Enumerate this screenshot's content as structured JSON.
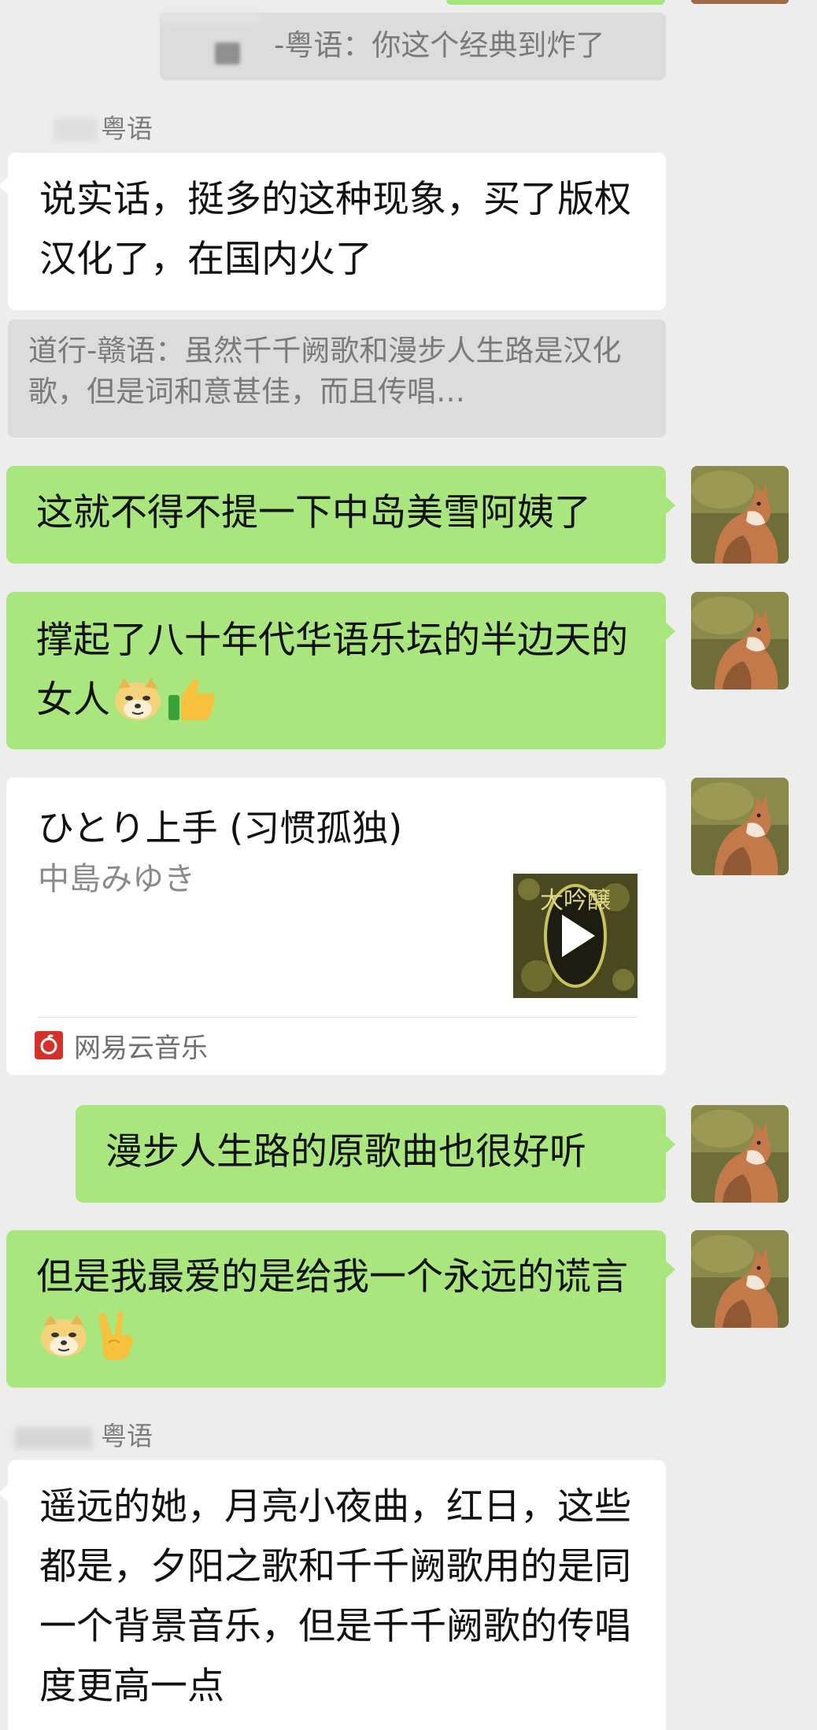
{
  "quotes": [
    {
      "text": "-粤语：你这个经典到炸了"
    },
    {
      "text": "道行-赣语：虽然千千阙歌和漫步人生路是汉化歌，但是词和意甚佳，而且传唱…"
    }
  ],
  "senders": [
    {
      "name": "粤语"
    },
    {
      "name": "粤语"
    }
  ],
  "messages": [
    {
      "text": "说实话，挺多的这种现象，买了版权汉化了，在国内火了"
    },
    {
      "text": "这就不得不提一下中岛美雪阿姨了"
    },
    {
      "text": " 撑起了八十年代华语乐坛的半边天的女人"
    },
    {
      "text": "漫步人生路的原歌曲也很好听"
    },
    {
      "text": "但是我最爱的是给我一个永远的谎言"
    },
    {
      "text": "遥远的她，月亮小夜曲，红日，这些都是，夕阳之歌和千千阙歌用的是同一个背景音乐，但是千千阙歌的传唱度更高一点"
    }
  ],
  "music_card": {
    "title": "ひとり上手 (习惯孤独)",
    "artist": "中島みゆき",
    "source": "网易云音乐",
    "cover_text": "大吟醸"
  },
  "icons": {
    "emoji_doge": "doge-emoji",
    "emoji_thumbs": "thumbs-up-emoji",
    "emoji_victory": "victory-hand-emoji",
    "play": "play-icon",
    "netease": "netease-music-icon",
    "avatar": "fox-avatar"
  },
  "colors": {
    "background": "#ededed",
    "bubble_self": "#a9e77e",
    "bubble_other": "#ffffff",
    "quote_bg": "#dcdcdc",
    "netease_red": "#d3312a"
  }
}
